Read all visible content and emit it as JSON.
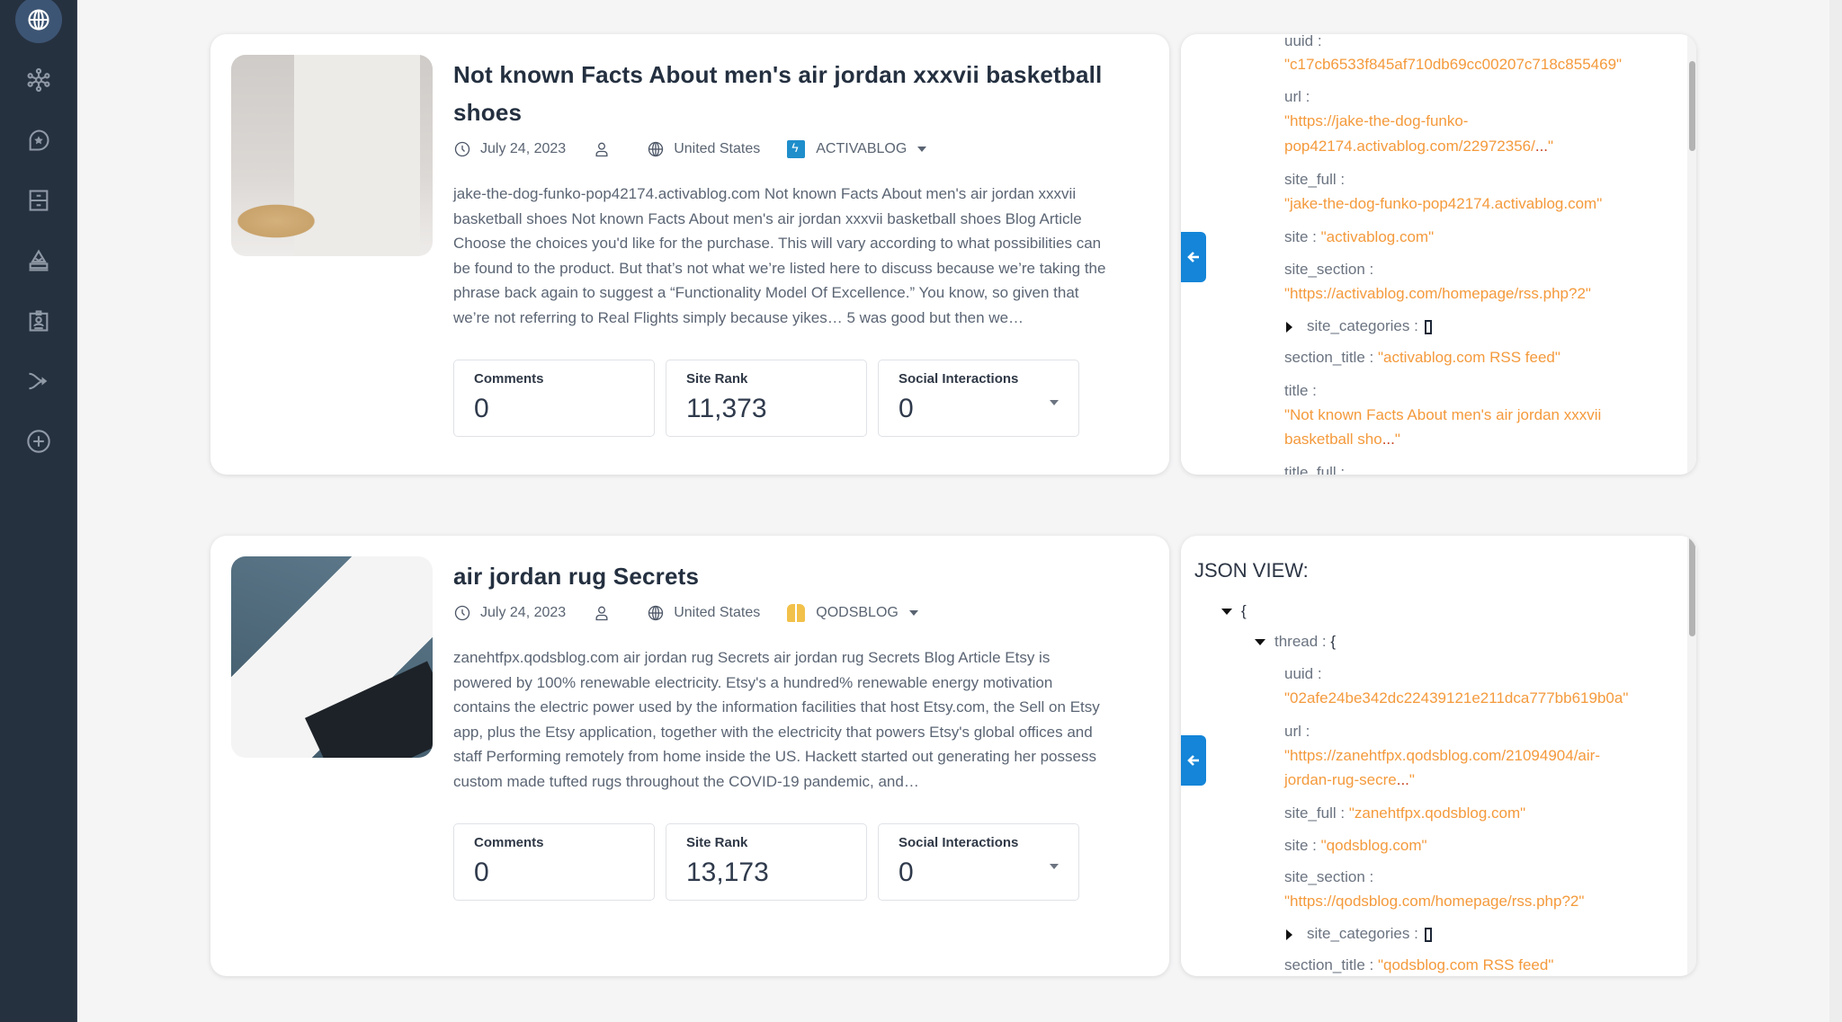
{
  "sidebar": {
    "items": [
      {
        "name": "globe",
        "active": true
      },
      {
        "name": "network"
      },
      {
        "name": "star-chat"
      },
      {
        "name": "archive"
      },
      {
        "name": "dark-web"
      },
      {
        "name": "badge"
      },
      {
        "name": "merge"
      },
      {
        "name": "add"
      }
    ]
  },
  "articles": [
    {
      "title": "Not known Facts About men's air jordan xxxvii basketball shoes",
      "date": "July 24, 2023",
      "country": "United States",
      "source": "ACTIVABLOG",
      "body": "jake-the-dog-funko-pop42174.activablog.com Not known Facts About men's air jordan xxxvii basketball shoes Not known Facts About men's air jordan xxxvii basketball shoes Blog Article Choose the choices you'd like for the purchase. This will vary according to what possibilities can be found to the product. But that’s not what we’re listed here to discuss because we’re taking the phrase back again to suggest a “Functionality Model Of Excellence.” You know, so given that we’re not referring to Real Flights simply because yikes… 5 was good but then we…",
      "stats": {
        "comments_label": "Comments",
        "comments": "0",
        "rank_label": "Site Rank",
        "rank": "11,373",
        "social_label": "Social Interactions",
        "social": "0"
      },
      "json": {
        "uuid_key": "uuid :",
        "uuid": "\"c17cb6533f845af710db69cc00207c718c855469\"",
        "url_key": "url :",
        "url_1": "\"https://jake-the-dog-funko-",
        "url_2": "pop42174.activablog.com/22972356/",
        "url_dots": "...",
        "url_end": "\"",
        "site_full_key": "site_full :",
        "site_full": "\"jake-the-dog-funko-pop42174.activablog.com\"",
        "site_key": "site :",
        "site": "\"activablog.com\"",
        "site_section_key": "site_section :",
        "site_section": "\"https://activablog.com/homepage/rss.php?2\"",
        "site_categories_key": "site_categories :",
        "section_title_key": "section_title :",
        "section_title": "\"activablog.com RSS feed\"",
        "title_key": "title :",
        "title_1": "\"Not known Facts About men's air jordan xxxvii",
        "title_2": "basketball sho",
        "title_dots": "...",
        "title_end": "\"",
        "title_full_key": "title_full :"
      }
    },
    {
      "title": "air jordan rug Secrets",
      "date": "July 24, 2023",
      "country": "United States",
      "source": "QODSBLOG",
      "body": "zanehtfpx.qodsblog.com air jordan rug Secrets air jordan rug Secrets Blog Article Etsy is powered by 100% renewable electricity. Etsy's a hundred% renewable energy motivation contains the electric power used by the information facilities that host Etsy.com, the Sell on Etsy app, plus the Etsy application, together with the electricity that powers Etsy's global offices and staff Performing remotely from home inside the US. Hackett started out generating her possess custom made tufted rugs throughout the COVID-19 pandemic, and…",
      "stats": {
        "comments_label": "Comments",
        "comments": "0",
        "rank_label": "Site Rank",
        "rank": "13,173",
        "social_label": "Social Interactions",
        "social": "0"
      },
      "json": {
        "header": "JSON VIEW:",
        "open_brace": "{",
        "thread_key": "thread :",
        "thread_brace": "{",
        "uuid_key": "uuid :",
        "uuid": "\"02afe24be342dc22439121e211dca777bb619b0a\"",
        "url_key": "url :",
        "url_1": "\"https://zanehtfpx.qodsblog.com/21094904/air-",
        "url_2": "jordan-rug-secre",
        "url_dots": "...",
        "url_end": "\"",
        "site_full_key": "site_full :",
        "site_full": "\"zanehtfpx.qodsblog.com\"",
        "site_key": "site :",
        "site": "\"qodsblog.com\"",
        "site_section_key": "site_section :",
        "site_section": "\"https://qodsblog.com/homepage/rss.php?2\"",
        "site_categories_key": "site_categories :",
        "section_title_key": "section_title :",
        "section_title": "\"qodsblog.com RSS feed\""
      }
    }
  ],
  "colors": {
    "sidebar_bg": "#263140",
    "accent_blue": "#1485d8",
    "json_string": "#f49a3c"
  }
}
